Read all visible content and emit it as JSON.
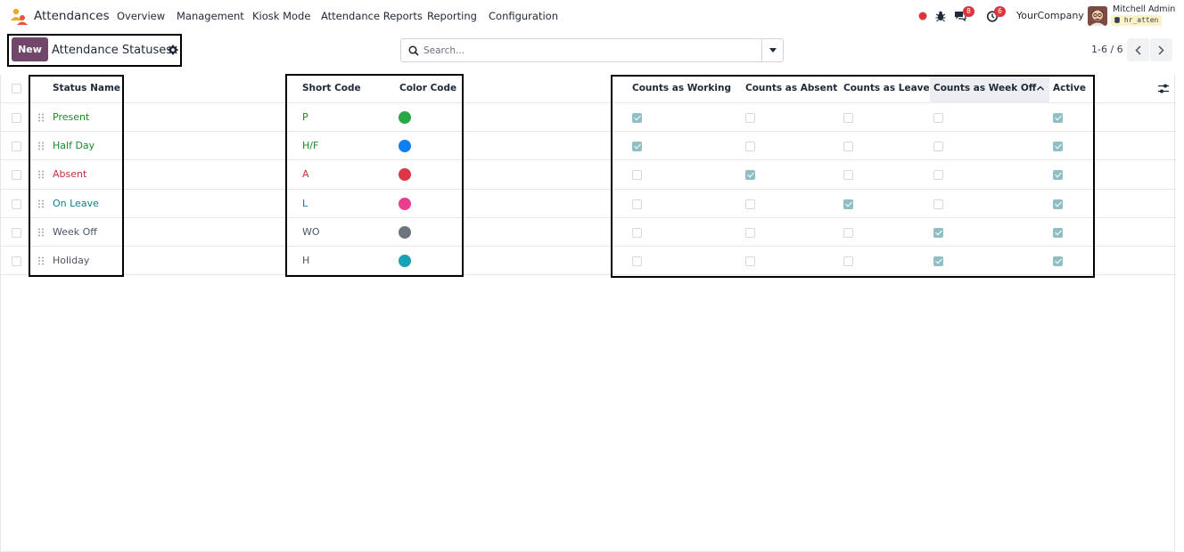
{
  "app": {
    "name": "Attendances",
    "menu": [
      "Overview",
      "Management",
      "Kiosk Mode",
      "Attendance Reports",
      "Reporting",
      "Configuration"
    ]
  },
  "systray": {
    "messages_count": "8",
    "activities_count": "6",
    "company": "YourCompany",
    "user_name": "Mitchell Admin",
    "database": "hr_atten"
  },
  "control_panel": {
    "new_label": "New",
    "title": "Attendance Statuses",
    "search_placeholder": "Search...",
    "pager": "1-6 / 6"
  },
  "table": {
    "columns": {
      "status_name": "Status Name",
      "short_code": "Short Code",
      "color_code": "Color Code",
      "working": "Counts as Working",
      "absent": "Counts as Absent",
      "leave": "Counts as Leave",
      "week_off": "Counts as Week Off",
      "active": "Active"
    },
    "rows": [
      {
        "name": "Present",
        "code": "P",
        "text_color": "#1b8a2c",
        "color": "#28a745",
        "working": true,
        "absent": false,
        "leave": false,
        "week_off": false,
        "active": true
      },
      {
        "name": "Half Day",
        "code": "H/F",
        "text_color": "#1b8a2c",
        "color": "#0d7ff0",
        "working": true,
        "absent": false,
        "leave": false,
        "week_off": false,
        "active": true
      },
      {
        "name": "Absent",
        "code": "A",
        "text_color": "#c8303c",
        "color": "#dc3545",
        "working": false,
        "absent": true,
        "leave": false,
        "week_off": false,
        "active": true
      },
      {
        "name": "On Leave",
        "code": "L",
        "text_color": "#0d7e8e",
        "color": "#e83e8c",
        "working": false,
        "absent": false,
        "leave": true,
        "week_off": false,
        "active": true
      },
      {
        "name": "Week Off",
        "code": "WO",
        "text_color": "#4b5563",
        "color": "#6c757d",
        "working": false,
        "absent": false,
        "leave": false,
        "week_off": true,
        "active": true
      },
      {
        "name": "Holiday",
        "code": "H",
        "text_color": "#4b5563",
        "color": "#17a2b8",
        "working": false,
        "absent": false,
        "leave": false,
        "week_off": true,
        "active": true
      }
    ]
  }
}
